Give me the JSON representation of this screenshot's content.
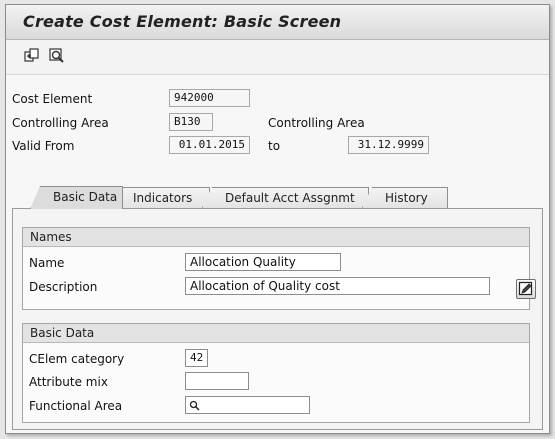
{
  "window": {
    "title": "Create Cost Element: Basic Screen"
  },
  "toolbar": {
    "icons": [
      "copy-icon",
      "display-icon"
    ]
  },
  "header": {
    "cost_element_label": "Cost Element",
    "cost_element_value": "942000",
    "controlling_area_label": "Controlling Area",
    "controlling_area_value": "B130",
    "controlling_area_desc_label": "Controlling Area",
    "valid_from_label": "Valid From",
    "valid_from_value": "01.01.2015",
    "to_label": "to",
    "valid_to_value": "31.12.9999"
  },
  "tabs": [
    {
      "label": "Basic Data",
      "active": true
    },
    {
      "label": "Indicators",
      "active": false
    },
    {
      "label": "Default Acct Assgnmt",
      "active": false
    },
    {
      "label": "History",
      "active": false
    }
  ],
  "names_group": {
    "title": "Names",
    "name_label": "Name",
    "name_value": "Allocation Quality",
    "description_label": "Description",
    "description_value": "Allocation of Quality cost"
  },
  "basic_group": {
    "title": "Basic Data",
    "celem_category_label": "CElem category",
    "celem_category_value": "42",
    "attribute_mix_label": "Attribute mix",
    "attribute_mix_value": "",
    "functional_area_label": "Functional Area",
    "functional_area_value": ""
  },
  "colors": {
    "background": "#f7f7f7",
    "field_border": "#9a9a9a"
  }
}
